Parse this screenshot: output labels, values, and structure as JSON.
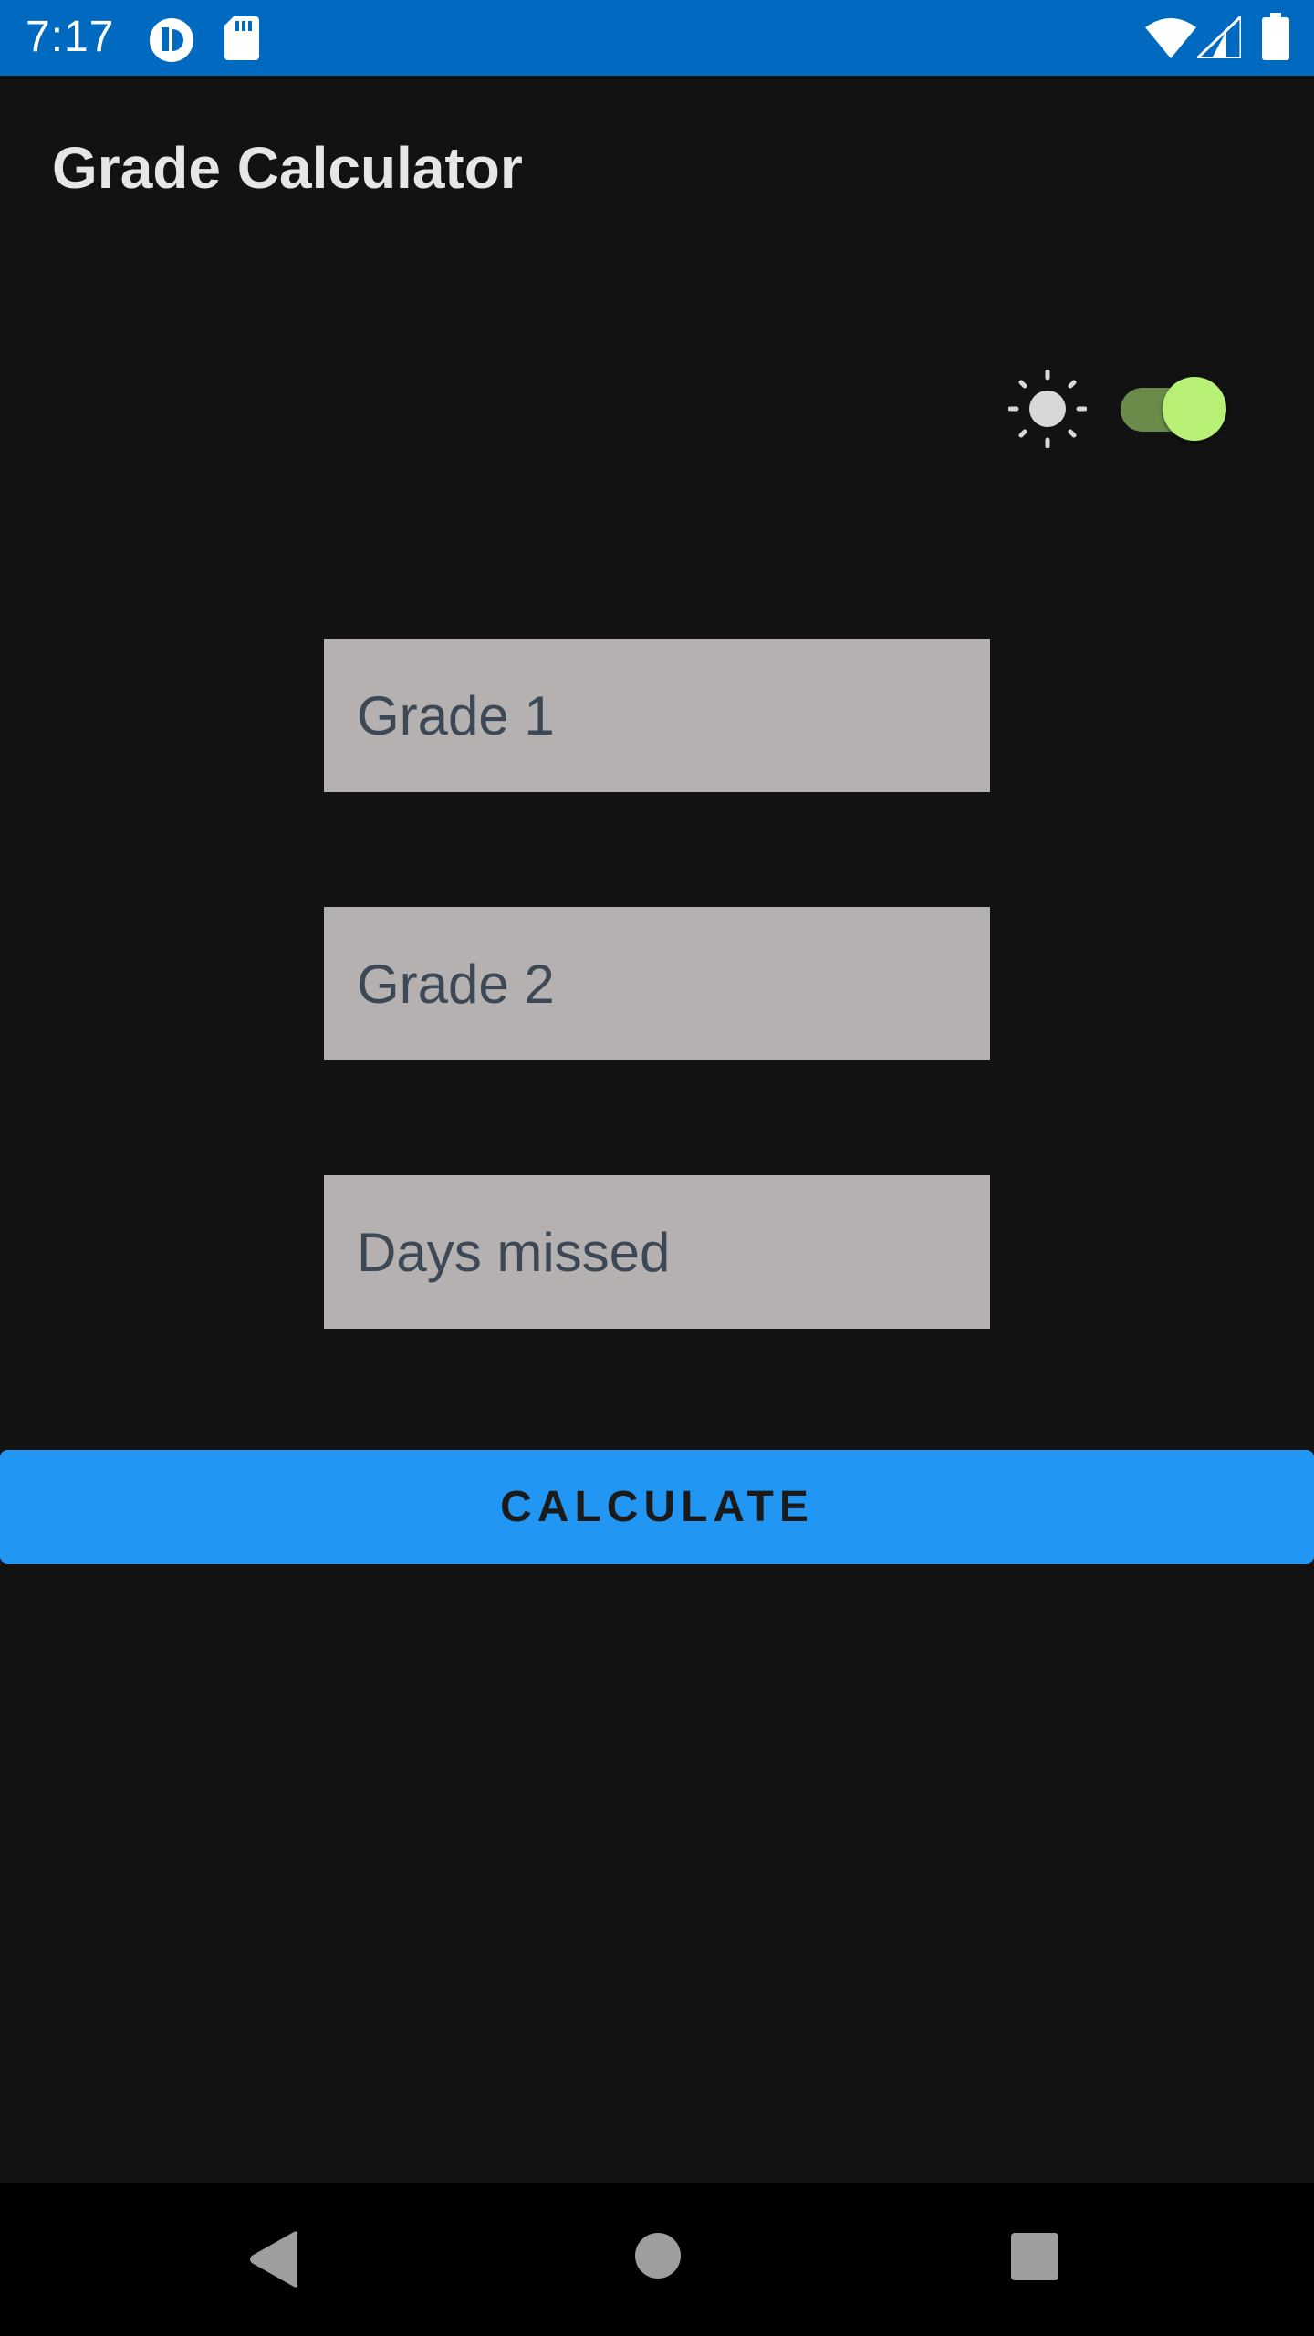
{
  "status_bar": {
    "time": "7:17",
    "background": "#0069c0",
    "icons": [
      "app-notification-icon",
      "sd-card-icon",
      "wifi-icon",
      "cell-signal-icon",
      "battery-icon"
    ]
  },
  "app": {
    "title": "Grade Calculator"
  },
  "theme_toggle": {
    "icon": "sun-icon",
    "state": "on",
    "thumb_color": "#b8f075",
    "track_color": "#6b8b4a"
  },
  "form": {
    "grade1": {
      "placeholder": "Grade 1",
      "value": ""
    },
    "grade2": {
      "placeholder": "Grade 2",
      "value": ""
    },
    "days_missed": {
      "placeholder": "Days missed",
      "value": ""
    },
    "field_background": "#b5b1b0"
  },
  "calculate_button": {
    "label": "CALCULATE",
    "color": "#2196f3"
  },
  "nav_bar": {
    "items": [
      "back-icon",
      "home-icon",
      "recents-icon"
    ]
  }
}
